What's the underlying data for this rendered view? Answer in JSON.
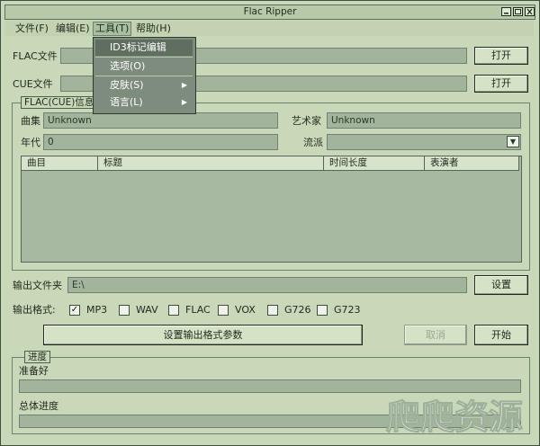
{
  "window": {
    "title": "Flac Ripper"
  },
  "menubar": {
    "items": [
      {
        "label": "文件(F)"
      },
      {
        "label": "编辑(E)"
      },
      {
        "label": "工具(T)"
      },
      {
        "label": "帮助(H)"
      }
    ]
  },
  "tools_menu": {
    "items": [
      {
        "label": "ID3标记编辑"
      },
      {
        "label": "选项(O)"
      },
      {
        "label": "皮肤(S)"
      },
      {
        "label": "语言(L)"
      }
    ]
  },
  "inputs": {
    "flac_label": "FLAC文件",
    "cue_label": "CUE文件",
    "open_button": "打开"
  },
  "info": {
    "group_title": "FLAC(CUE)信息",
    "album_label": "曲集",
    "album_value": "Unknown",
    "artist_label": "艺术家",
    "artist_value": "Unknown",
    "year_label": "年代",
    "year_value": "0",
    "genre_label": "流派",
    "genre_value": "",
    "columns": [
      "曲目",
      "标题",
      "时间长度",
      "表演者"
    ]
  },
  "output": {
    "folder_label": "输出文件夹",
    "folder_value": "E:\\",
    "settings_button": "设置",
    "format_label": "输出格式:",
    "formats": [
      {
        "label": "MP3",
        "checked": true
      },
      {
        "label": "WAV",
        "checked": false
      },
      {
        "label": "FLAC",
        "checked": false
      },
      {
        "label": "VOX",
        "checked": false
      },
      {
        "label": "G726",
        "checked": false
      },
      {
        "label": "G723",
        "checked": false
      }
    ],
    "format_params_button": "设置输出格式参数",
    "cancel_button": "取消",
    "start_button": "开始"
  },
  "progress": {
    "group_title": "进度",
    "status": "准备好",
    "overall_label": "总体进度",
    "current_progress": 0,
    "overall_progress": 0
  },
  "watermark": {
    "text": "爬爬资源"
  },
  "colors": {
    "window_bg": "#c9d8b8",
    "field_bg": "#a2b49b",
    "menu_bg": "#7d8c7d",
    "menu_selected": "#5f6e5f"
  }
}
